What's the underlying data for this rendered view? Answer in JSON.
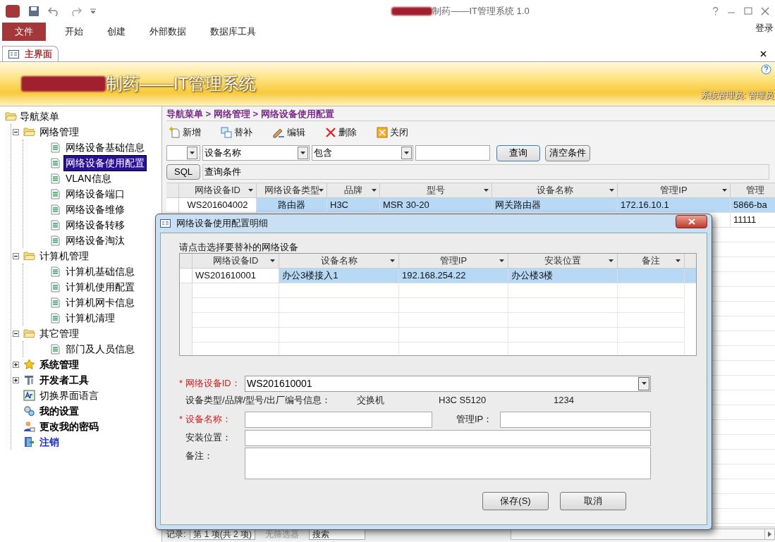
{
  "window": {
    "title": "制药——IT管理系统 1.0",
    "login": "登录"
  },
  "ribbon_tabs": [
    {
      "label": "文件",
      "selected": true
    },
    {
      "label": "开始",
      "selected": false
    },
    {
      "label": "创建",
      "selected": false
    },
    {
      "label": "外部数据",
      "selected": false
    },
    {
      "label": "数据库工具",
      "selected": false
    }
  ],
  "document_tab": {
    "label": "主界面"
  },
  "banner": {
    "title": "制药——IT管理系统",
    "user": "系统管理员: 管理员"
  },
  "sidebar": {
    "root": "导航菜单",
    "items": [
      {
        "label": "网络管理",
        "kind": "folder",
        "expanded": true,
        "children": [
          {
            "label": "网络设备基础信息",
            "kind": "page",
            "selected": false
          },
          {
            "label": "网络设备使用配置",
            "kind": "page",
            "selected": true
          },
          {
            "label": "VLAN信息",
            "kind": "page",
            "selected": false
          },
          {
            "label": "网络设备端口",
            "kind": "page",
            "selected": false
          },
          {
            "label": "网络设备维修",
            "kind": "page",
            "selected": false
          },
          {
            "label": "网络设备转移",
            "kind": "page",
            "selected": false
          },
          {
            "label": "网络设备淘汰",
            "kind": "page",
            "selected": false
          }
        ]
      },
      {
        "label": "计算机管理",
        "kind": "folder",
        "expanded": true,
        "children": [
          {
            "label": "计算机基础信息",
            "kind": "page",
            "selected": false
          },
          {
            "label": "计算机使用配置",
            "kind": "page",
            "selected": false
          },
          {
            "label": "计算机网卡信息",
            "kind": "page",
            "selected": false
          },
          {
            "label": "计算机清理",
            "kind": "page",
            "selected": false
          }
        ]
      },
      {
        "label": "其它管理",
        "kind": "folder",
        "expanded": true,
        "children": [
          {
            "label": "部门及人员信息",
            "kind": "page",
            "selected": false
          }
        ]
      },
      {
        "label": "系统管理",
        "kind": "star",
        "expanded": false
      },
      {
        "label": "开发者工具",
        "kind": "tool",
        "expanded": false
      },
      {
        "label": "切换界面语言",
        "kind": "language"
      },
      {
        "label": "我的设置",
        "kind": "settings"
      },
      {
        "label": "更改我的密码",
        "kind": "user"
      },
      {
        "label": "注销",
        "kind": "logout"
      }
    ]
  },
  "breadcrumb": "导航菜单 > 网络管理 > 网络设备使用配置",
  "toolbar": [
    {
      "label": "新增",
      "kind": "add"
    },
    {
      "label": "替补",
      "kind": "replace"
    },
    {
      "label": "编辑",
      "kind": "edit"
    },
    {
      "label": "删除",
      "kind": "delete"
    },
    {
      "label": "关闭",
      "kind": "close"
    }
  ],
  "filter": {
    "field": "设备名称",
    "operator": "包含",
    "query_button": "查询",
    "clear_button": "清空条件",
    "sql_button": "SQL",
    "sql_text": "查询条件"
  },
  "table": {
    "columns": [
      "网络设备ID",
      "网络设备类型",
      "品牌",
      "型号",
      "设备名称",
      "管理IP",
      "管理"
    ],
    "rows": [
      {
        "selected": true,
        "cells": [
          "WS201604002",
          "路由器",
          "H3C",
          "MSR 30-20",
          "网关路由器",
          "172.16.10.1",
          "5866-ba"
        ]
      },
      {
        "selected": false,
        "cells": [
          null,
          null,
          null,
          null,
          null,
          null,
          "11111"
        ]
      }
    ]
  },
  "record_bar": {
    "label": "记录:",
    "position": "第 1 项(共 2 项)",
    "filter": "无筛选器",
    "search": "搜索"
  },
  "dialog": {
    "title": "网络设备使用配置明细",
    "prompt": "请点击选择要替补的网络设备",
    "grid": {
      "columns": [
        "网络设备ID",
        "设备名称",
        "管理IP",
        "安装位置",
        "备注"
      ],
      "rows": [
        {
          "selected": true,
          "cells": [
            "WS201610001",
            "办公3楼接入1",
            "192.168.254.22",
            "办公楼3楼",
            null
          ]
        }
      ]
    },
    "device_id": {
      "label": "* 网络设备ID：",
      "required": true,
      "value": "WS201610001"
    },
    "info": {
      "label": "设备类型/品牌/型号/出厂编号信息：",
      "values": [
        "交换机",
        "H3C S5120",
        "1234"
      ]
    },
    "device_name": {
      "label": "* 设备名称：",
      "required": true
    },
    "manage_ip": {
      "label": "管理IP："
    },
    "location": {
      "label": "安装位置：",
      "required": false
    },
    "note": {
      "label": "备注：",
      "required": false
    },
    "buttons": [
      "保存(S)",
      "取消"
    ]
  }
}
